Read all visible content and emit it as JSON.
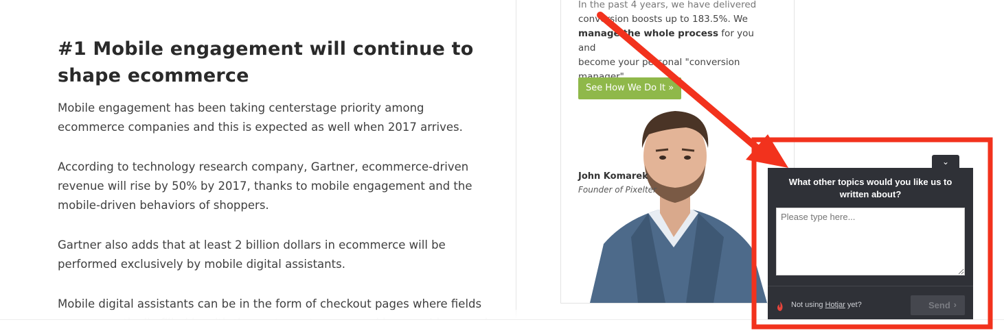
{
  "article": {
    "heading": "#1 Mobile engagement will continue to shape ecommerce",
    "paragraphs": [
      "Mobile engagement has been taking centerstage priority among ecommerce companies and this is expected as well when 2017 arrives.",
      "According to technology research company, Gartner, ecommerce-driven revenue will rise by 50% by 2017, thanks to mobile engagement and the mobile-driven behaviors of shoppers.",
      "Gartner also adds that at least 2 billion dollars in ecommerce will be performed exclusively by mobile digital assistants.",
      "Mobile digital assistants can be in the form of checkout pages where fields are automatically filled in with the customer’s name and home address and"
    ]
  },
  "sidebar": {
    "text_line1": "In the past 4 years, we have delivered",
    "text_line2": "conversion boosts up to 183.5%. We",
    "text_bold": "manage the whole process",
    "text_line3_rest": " for you and",
    "text_line4": "become your personal \"conversion",
    "text_line5": "manager\".",
    "cta_label": "See How We Do It »",
    "author_name": "John Komarek",
    "author_role": "Founder of Pixelter"
  },
  "poll": {
    "toggle_icon": "chevron-down-icon",
    "question": "What other topics would you like us to written about?",
    "placeholder": "Please type here...",
    "note_prefix": "Not using ",
    "note_link": "Hotjar",
    "note_suffix": " yet?",
    "send_label": "Send"
  },
  "colors": {
    "annotation_red": "#f2321d",
    "cta_green": "#8fb84a",
    "poll_bg": "#2f3137"
  }
}
